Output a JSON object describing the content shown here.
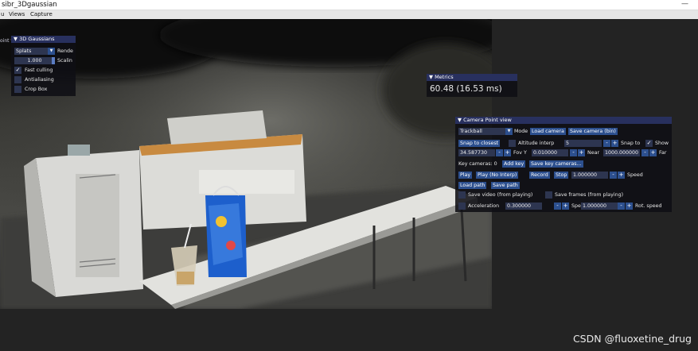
{
  "window": {
    "title": "sibr_3Dgaussian",
    "controls": "—"
  },
  "menu": {
    "items": [
      "u",
      "Views",
      "Capture"
    ]
  },
  "viewport": {
    "label": "oint view"
  },
  "gaussians_panel": {
    "title": "3D Gaussians",
    "render_mode": "Splats",
    "render_label": "Rende",
    "scale_value": "1.000",
    "scale_label": "Scalin",
    "fast_culling": {
      "label": "Fast culling",
      "checked": true
    },
    "antialiasing": {
      "label": "Antialiasing",
      "checked": false
    },
    "crop_box": {
      "label": "Crop Box",
      "checked": false
    }
  },
  "metrics_panel": {
    "title": "Metrics",
    "value": "60.48 (16.53 ms)"
  },
  "camera_panel": {
    "title": "Camera Point view",
    "mode_value": "Trackball",
    "mode_label": "Mode",
    "load_camera": "Load camera",
    "save_camera": "Save camera (bin)",
    "snap_closest": "Snap to closest",
    "altitude_label": "Altitude interp",
    "altitude_value": "5",
    "snap_to_label": "Snap to",
    "show_label": "Show",
    "fov_value": "34.587730",
    "fov_label": "Fov Y",
    "near_value": "0.010000",
    "near_label": "Near",
    "far_value": "1000.000000",
    "far_label": "Far",
    "key_cameras_label": "Key cameras: 0",
    "add_key": "Add key",
    "save_key_cameras": "Save key cameras...",
    "play": "Play",
    "play_no_interp": "Play (No Interp)",
    "record": "Record",
    "stop": "Stop",
    "speed_value": "1.000000",
    "speed_label": "Speed",
    "load_path": "Load path",
    "save_path": "Save path",
    "save_video_label": "Save video (from playing)",
    "save_frames_label": "Save frames (from playing)",
    "acceleration_label": "Acceleration",
    "acceleration_value": "0.300000",
    "speed2_label": "Speed",
    "speed2_value": "1.000000",
    "rot_speed_label": "Rot. speed",
    "minus": "-",
    "plus": "+"
  },
  "watermark": "CSDN @fluoxetine_drug"
}
